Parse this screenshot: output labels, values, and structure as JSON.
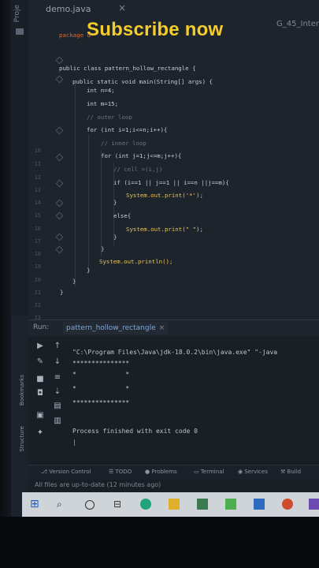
{
  "editor": {
    "tab_file": "demo.java",
    "tab_right": "G_45_Inter",
    "sidebar_label": "Proje",
    "overlay_text": "Subscribe now",
    "package_stub": "package d",
    "line_numbers": [
      "10",
      "11",
      "12",
      "13",
      "14",
      "15",
      "16",
      "17",
      "18",
      "19",
      "20",
      "21",
      "22",
      "23"
    ],
    "code": {
      "l_class": "public class pattern_hollow_rectangle {",
      "l_main": "public static void main(String[] args) {",
      "l_n": "int n=4;",
      "l_m": "int m=15;",
      "l_c1": "// outer loop",
      "l_for1": "for (int i=1;i<=n;i++){",
      "l_c2": "// inner loop",
      "l_for2": "for (int j=1;j<=m;j++){",
      "l_c3": "// cell =(i,j)",
      "l_if": "if (i==1 || j==1 || i==n ||j==m){",
      "l_p1": "System.out.print('*');",
      "l_b1": "}",
      "l_else": "else{",
      "l_p2": "System.out.print(\" \");",
      "l_b2": "}",
      "l_b3": "}",
      "l_pln": "System.out.println();",
      "l_b4": "}",
      "l_b5": "}",
      "l_b6": "}"
    }
  },
  "run": {
    "label": "Run:",
    "tab": "pattern_hollow_rectangle",
    "cmd": "\"C:\\Program Files\\Java\\jdk-18.0.2\\bin\\java.exe\" \"-java",
    "out1": "***************",
    "out2": "*             *",
    "out3": "*             *",
    "out4": "***************",
    "finish": "Process finished with exit code 0",
    "side_bookmarks": "Bookmarks",
    "side_structure": "Structure"
  },
  "bottombar": {
    "items": [
      "Version Control",
      "TODO",
      "Problems",
      "Terminal",
      "Services",
      "Build"
    ]
  },
  "status": {
    "text": "All files are up-to-date (12 minutes ago)"
  }
}
